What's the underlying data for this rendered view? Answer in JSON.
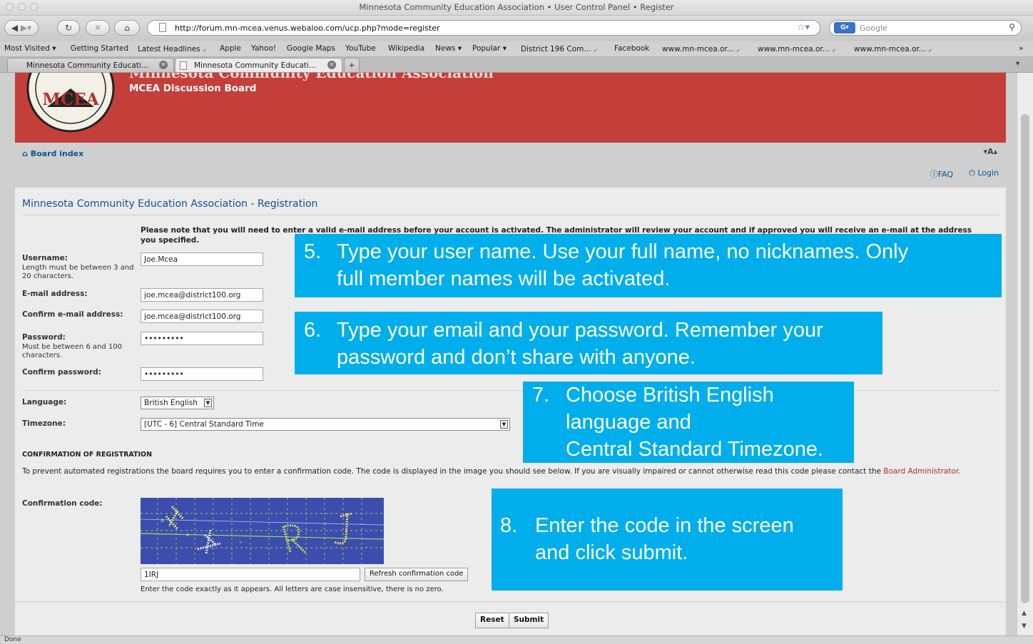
{
  "window": {
    "title": "Minnesota Community Education Association • User Control Panel • Register"
  },
  "navbar": {
    "url": "http://forum.mn-mcea.venus.webaloo.com/ucp.php?mode=register",
    "search_placeholder": "Google"
  },
  "bookmarks": [
    "Most Visited ▾",
    "Getting Started",
    "Latest Headlines ⸝",
    "Apple",
    "Yahoo!",
    "Google Maps",
    "YouTube",
    "Wikipedia",
    "News ▾",
    "Popular ▾",
    "District 196 Com... ⸝",
    "Facebook",
    "www.mn-mcea.or... ⸝",
    "www.mn-mcea.or... ⸝",
    "www.mn-mcea.or... ⸝"
  ],
  "tabs": [
    {
      "label": "Minnesota Community Educati..."
    },
    {
      "label": "Minnesota Community Educati..."
    }
  ],
  "header": {
    "site_title": "Minnesota Community Education Association",
    "subtitle": "MCEA Discussion Board",
    "logo_text": "MCEA"
  },
  "nav": {
    "board_index": "Board index",
    "font_size": "▾A▴",
    "faq": "FAQ",
    "login": "Login"
  },
  "form": {
    "heading": "Minnesota Community Education Association - Registration",
    "note": "Please note that you will need to enter a valid e-mail address before your account is activated. The administrator will review your account and if approved you will receive an e-mail at the address you specified.",
    "username_label": "Username:",
    "username_hint": "Length must be between 3 and 20 characters.",
    "username_value": "Joe.Mcea",
    "email_label": "E-mail address:",
    "email_value": "joe.mcea@district100.org",
    "confirm_email_label": "Confirm e-mail address:",
    "confirm_email_value": "joe.mcea@district100.org",
    "password_label": "Password:",
    "password_hint": "Must be between 6 and 100 characters.",
    "password_value": "•••••••••",
    "confirm_password_label": "Confirm password:",
    "confirm_password_value": "•••••••••",
    "language_label": "Language:",
    "language_value": "British English",
    "timezone_label": "Timezone:",
    "timezone_value": "[UTC - 6] Central Standard Time"
  },
  "confirmation": {
    "heading": "CONFIRMATION OF REGISTRATION",
    "text": "To prevent automated registrations the board requires you to enter a confirmation code. The code is displayed in the image you should see below. If you are visually impaired or cannot otherwise read this code please contact the ",
    "link": "Board Administrator",
    "text_end": ".",
    "code_label": "Confirmation code:",
    "code_image_text": "1IRJ",
    "code_value": "1IRJ",
    "refresh_button": "Refresh confirmation code",
    "explanation": "Enter the code exactly as it appears. All letters are case insensitive, there is no zero."
  },
  "buttons": {
    "reset": "Reset",
    "submit": "Submit"
  },
  "callouts": [
    {
      "number": "5.",
      "text": "Type your user name. Use your full name, no nicknames. Only\nfull member names will be activated."
    },
    {
      "number": "6.",
      "text": "Type your email and your password. Remember your\npassword and don’t share with anyone."
    },
    {
      "number": "7.",
      "text": "Choose British English\nlanguage and\nCentral Standard Timezone."
    },
    {
      "number": "8.",
      "text": "Enter the code in the screen\nand click submit."
    }
  ],
  "status": "Done",
  "colors": {
    "header_red": "#c53f3a",
    "link_blue": "#105289",
    "callout_cyan": "#00aeec",
    "captcha_blue": "#3c4dae"
  }
}
